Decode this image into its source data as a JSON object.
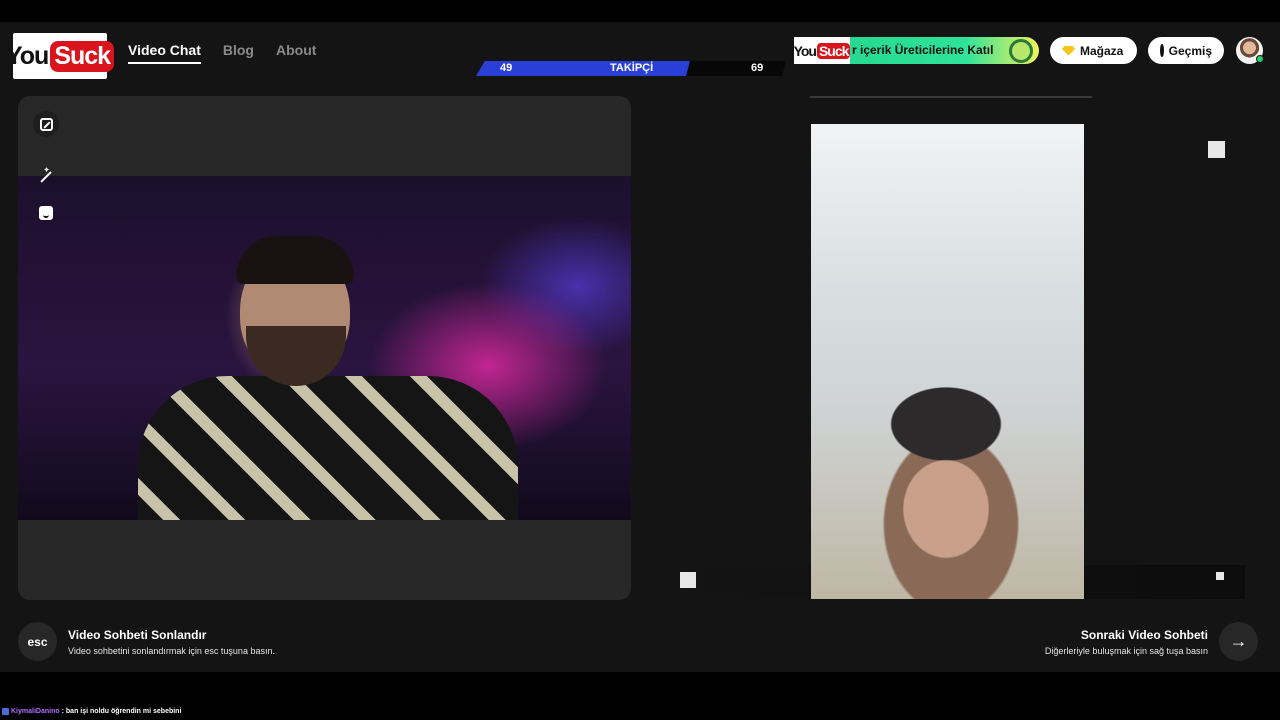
{
  "header": {
    "logo": {
      "part1": "You",
      "part2": "Suck"
    },
    "nav": [
      {
        "label": "Video Chat",
        "active": true
      },
      {
        "label": "Blog",
        "active": false
      },
      {
        "label": "About",
        "active": false
      }
    ],
    "followers": {
      "left": "49",
      "label": "TAKİPÇİ",
      "right": "69",
      "progress": 0.71
    },
    "promo": {
      "text": "r içerik Üreticilerine Katıl"
    },
    "shop_label": "Mağaza",
    "history_label": "Geçmiş",
    "colors": {
      "accent_blue": "#2a3fd6",
      "brand_red": "#d9141c",
      "promo_green": "#2fe39a"
    }
  },
  "controls": {
    "expand_icon": "expand-icon",
    "wand_icon": "magic-wand-icon",
    "face_icon": "face-filter-icon"
  },
  "footer": {
    "end": {
      "key": "esc",
      "title": "Video Sohbeti Sonlandır",
      "subtitle": "Video sohbetini sonlandırmak için esc tuşuna basın."
    },
    "next": {
      "key": "→",
      "title": "Sonraki Video Sohbeti",
      "subtitle": "Diğerleriyle buluşmak için sağ tuşa basın"
    }
  },
  "chat": {
    "user": "KiymaliDanino",
    "message": ": ban işi noldu öğrendin mi sebebini"
  }
}
